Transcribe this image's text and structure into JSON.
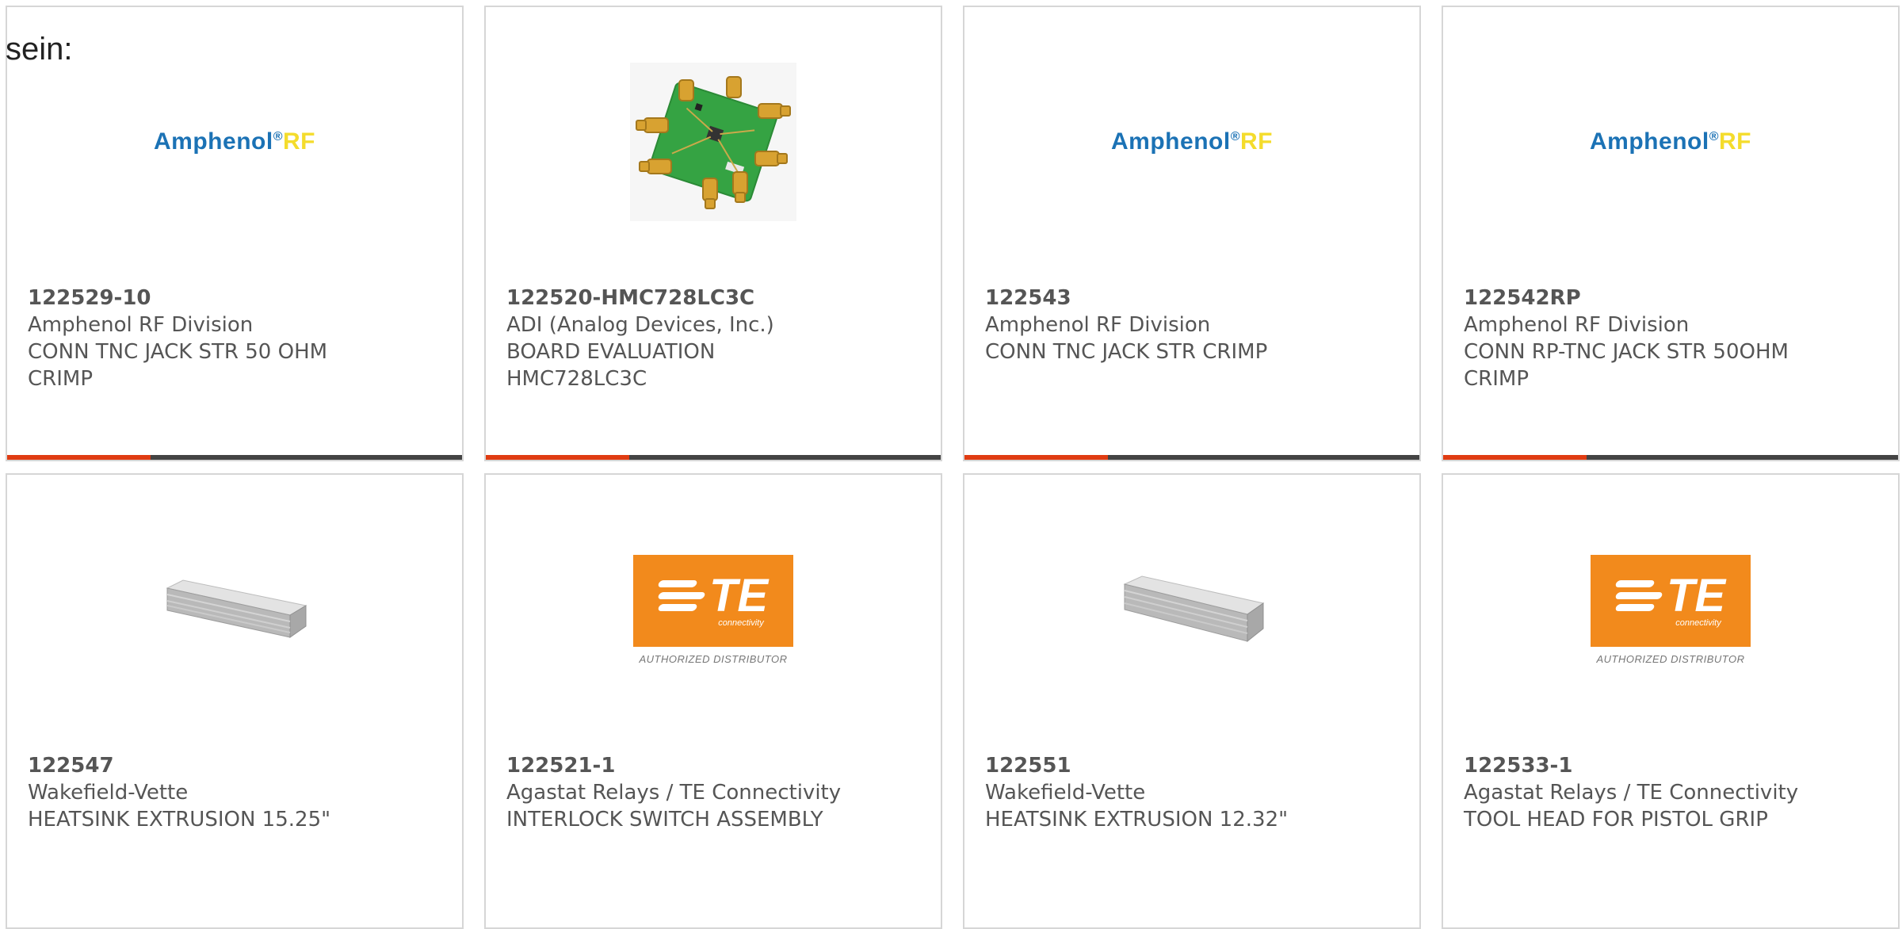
{
  "lead_text": "sein:",
  "logos": {
    "amphenol_name": "Amphenol",
    "amphenol_reg": "®",
    "amphenol_rf": "RF",
    "te_name": "TE",
    "te_sub": "connectivity",
    "te_authorized": "AUTHORIZED DISTRIBUTOR"
  },
  "colors": {
    "accent_bar": "#e03c12",
    "bar_track": "#444444",
    "te_orange": "#f28a1c",
    "amphenol_blue": "#1b72b5",
    "amphenol_yellow": "#f4dc2c"
  },
  "products": [
    {
      "part_number": "122529-10",
      "manufacturer": "Amphenol RF Division",
      "description": "CONN TNC JACK STR 50 OHM CRIMP",
      "image": "amphenol-rf-logo"
    },
    {
      "part_number": "122520-HMC728LC3C",
      "manufacturer": "ADI (Analog Devices, Inc.)",
      "description": "BOARD EVALUATION HMC728LC3C",
      "image": "evaluation-board-photo"
    },
    {
      "part_number": "122543",
      "manufacturer": "Amphenol RF Division",
      "description": "CONN TNC JACK STR CRIMP",
      "image": "amphenol-rf-logo"
    },
    {
      "part_number": "122542RP",
      "manufacturer": "Amphenol RF Division",
      "description": "CONN RP-TNC JACK STR 50OHM CRIMP",
      "image": "amphenol-rf-logo"
    },
    {
      "part_number": "122547",
      "manufacturer": "Wakefield-Vette",
      "description": "HEATSINK EXTRUSION 15.25\"",
      "image": "heatsink-photo"
    },
    {
      "part_number": "122521-1",
      "manufacturer": "Agastat Relays / TE Connectivity",
      "description": "INTERLOCK SWITCH ASSEMBLY",
      "image": "te-connectivity-logo"
    },
    {
      "part_number": "122551",
      "manufacturer": "Wakefield-Vette",
      "description": "HEATSINK EXTRUSION 12.32\"",
      "image": "heatsink-photo"
    },
    {
      "part_number": "122533-1",
      "manufacturer": "Agastat Relays / TE Connectivity",
      "description": "TOOL HEAD FOR PISTOL GRIP",
      "image": "te-connectivity-logo"
    }
  ]
}
